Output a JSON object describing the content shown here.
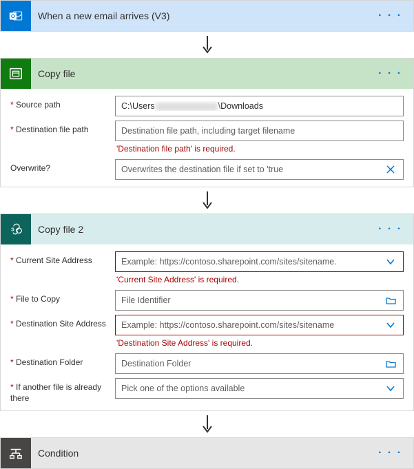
{
  "trigger": {
    "title": "When a new email arrives (V3)"
  },
  "copyfile": {
    "title": "Copy file",
    "fields": {
      "source_path": {
        "label": "Source path",
        "value_prefix": "C:\\Users",
        "value_suffix": "\\Downloads"
      },
      "dest_path": {
        "label": "Destination file path",
        "placeholder": "Destination file path, including target filename",
        "error": "'Destination file path' is required."
      },
      "overwrite": {
        "label": "Overwrite?",
        "placeholder": "Overwrites the destination file if set to 'true"
      }
    }
  },
  "copyfile2": {
    "title": "Copy file 2",
    "fields": {
      "site_addr": {
        "label": "Current Site Address",
        "placeholder": "Example: https://contoso.sharepoint.com/sites/sitename.",
        "error": "'Current Site Address' is required."
      },
      "file_to_copy": {
        "label": "File to Copy",
        "placeholder": "File Identifier"
      },
      "dest_site": {
        "label": "Destination Site Address",
        "placeholder": "Example: https://contoso.sharepoint.com/sites/sitename",
        "error": "'Destination Site Address' is required."
      },
      "dest_folder": {
        "label": "Destination Folder",
        "placeholder": "Destination Folder"
      },
      "if_exists": {
        "label": "If another file is already there",
        "placeholder": "Pick one of the options available"
      }
    }
  },
  "condition": {
    "title": "Condition"
  }
}
